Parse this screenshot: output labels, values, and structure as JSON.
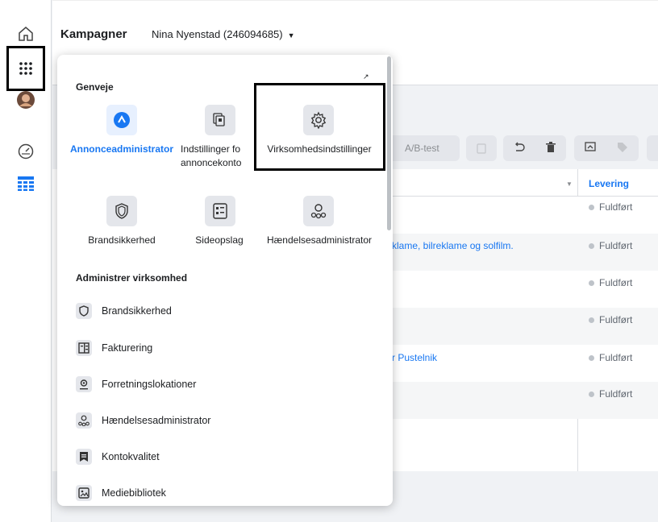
{
  "header": {
    "title": "Kampagner",
    "account": "Nina Nyenstad (246094685)",
    "account_caret": "▼"
  },
  "toolbar": {
    "ab_test": "A/B-test"
  },
  "table": {
    "delivery_header": "Levering",
    "rows": [
      {
        "name": "",
        "status": "Fuldført"
      },
      {
        "name": "klame, bilreklame og solfilm.",
        "status": "Fuldført"
      },
      {
        "name": "",
        "status": "Fuldført"
      },
      {
        "name": "",
        "status": "Fuldført"
      },
      {
        "name": "r Pustelnik",
        "status": "Fuldført"
      },
      {
        "name": "",
        "status": "Fuldført"
      }
    ]
  },
  "menu": {
    "shortcuts_heading": "Genveje",
    "external_glyph": "↗",
    "shortcuts": [
      {
        "label": "Annonceadministrator",
        "icon": "ads-manager-icon",
        "active": true
      },
      {
        "label": "Indstillinger fo\nannoncekonto",
        "icon": "ad-account-settings-icon"
      },
      {
        "label": "Virksomhedsindstillinger",
        "icon": "gear-icon"
      },
      {
        "label": "Brandsikkerhed",
        "icon": "shield-icon"
      },
      {
        "label": "Sideopslag",
        "icon": "page-posts-icon"
      },
      {
        "label": "Hændelsesadministrator",
        "icon": "events-manager-icon"
      }
    ],
    "manage_heading": "Administrer virksomhed",
    "manage_items": [
      {
        "label": "Brandsikkerhed",
        "icon": "shield-icon"
      },
      {
        "label": "Fakturering",
        "icon": "billing-icon"
      },
      {
        "label": "Forretningslokationer",
        "icon": "location-icon"
      },
      {
        "label": "Hændelsesadministrator",
        "icon": "events-manager-icon"
      },
      {
        "label": "Kontokvalitet",
        "icon": "account-quality-icon"
      },
      {
        "label": "Mediebibliotek",
        "icon": "media-library-icon"
      }
    ]
  },
  "colors": {
    "accent": "#1877f2",
    "status_dot": "#bec3c9",
    "highlight": "#000000"
  }
}
